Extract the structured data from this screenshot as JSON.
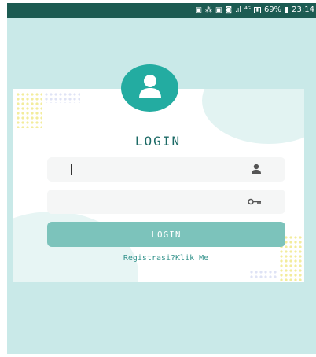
{
  "status_bar": {
    "icons": [
      "gallery-icon",
      "wifi-icon",
      "gallery-icon",
      "sim-icon",
      "signal-icon",
      "lte-icon"
    ],
    "battery": "69%",
    "time": "23:14"
  },
  "login": {
    "title": "LOGIN",
    "username_value": "",
    "password_value": "",
    "button_label": "LOGIN",
    "register_link": "Registrasi?Klik Me"
  },
  "colors": {
    "screen_bg": "#c9e9e8",
    "status_bar": "#1c5b52",
    "avatar_bg": "#23aca1",
    "title": "#1c6a66",
    "button": "#7cc3bb",
    "link": "#36948d"
  }
}
